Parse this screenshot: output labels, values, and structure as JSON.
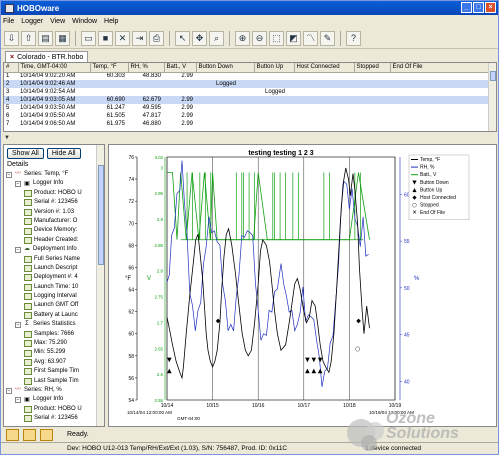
{
  "app": {
    "title": "HOBOware",
    "min_glyph": "_",
    "max_glyph": "□",
    "close_glyph": "×"
  },
  "menu": [
    "File",
    "Logger",
    "View",
    "Window",
    "Help"
  ],
  "document_tab": {
    "label": "Colorado - BTR.hobo",
    "close_glyph": "×"
  },
  "table": {
    "columns": [
      "#",
      "Time, GMT-04:00",
      "Temp, °F",
      "RH, %",
      "Batt., V",
      "Button Down",
      "Button Up",
      "Host Connected",
      "Stopped",
      "End Of File"
    ],
    "rows": [
      [
        "1",
        "10/14/04 9:02:20 AM",
        "60.303",
        "48.830",
        "2.99",
        "",
        "",
        "",
        "",
        ""
      ],
      [
        "2",
        "10/14/04 9:02:46 AM",
        "",
        "",
        "",
        "Logged",
        "",
        "",
        "",
        ""
      ],
      [
        "3",
        "10/14/04 9:02:54 AM",
        "",
        "",
        "",
        "",
        "Logged",
        "",
        "",
        ""
      ],
      [
        "4",
        "10/14/04 9:03:05 AM",
        "60.690",
        "62.679",
        "2.99",
        "",
        "",
        "",
        "",
        ""
      ],
      [
        "5",
        "10/14/04 9:03:50 AM",
        "61.247",
        "49.595",
        "2.99",
        "",
        "",
        "",
        "",
        ""
      ],
      [
        "6",
        "10/14/04 9:05:50 AM",
        "61.505",
        "47.817",
        "2.99",
        "",
        "",
        "",
        "",
        ""
      ],
      [
        "7",
        "10/14/04 9:06:50 AM",
        "61.975",
        "46.880",
        "2.99",
        "",
        "",
        "",
        "",
        ""
      ]
    ],
    "selected_rows": [
      1,
      3
    ]
  },
  "left_panel": {
    "show_all": "Show All",
    "hide_all": "Hide All",
    "details": "Details",
    "tree": [
      {
        "level": 0,
        "pm": "−",
        "icon": "chart-icon",
        "glyph": "〰",
        "label": "Series: Temp, °F"
      },
      {
        "level": 1,
        "pm": "−",
        "icon": "logger-icon",
        "glyph": "▣",
        "label": "Logger Info"
      },
      {
        "level": 2,
        "pm": "",
        "icon": "info-icon",
        "glyph": "",
        "label": "Product: HOBO U"
      },
      {
        "level": 2,
        "pm": "",
        "icon": "info-icon",
        "glyph": "",
        "label": "Serial #: 123456"
      },
      {
        "level": 2,
        "pm": "",
        "icon": "info-icon",
        "glyph": "",
        "label": "Version #: 1.03"
      },
      {
        "level": 2,
        "pm": "",
        "icon": "info-icon",
        "glyph": "",
        "label": "Manufacturer: O"
      },
      {
        "level": 2,
        "pm": "",
        "icon": "info-icon",
        "glyph": "",
        "label": "Device Memory:"
      },
      {
        "level": 2,
        "pm": "",
        "icon": "info-icon",
        "glyph": "",
        "label": "Header Created:"
      },
      {
        "level": 1,
        "pm": "−",
        "icon": "deployment-icon",
        "glyph": "☁",
        "label": "Deployment Info"
      },
      {
        "level": 2,
        "pm": "",
        "icon": "info-icon",
        "glyph": "",
        "label": "Full Series Name"
      },
      {
        "level": 2,
        "pm": "",
        "icon": "info-icon",
        "glyph": "",
        "label": "Launch Descript"
      },
      {
        "level": 2,
        "pm": "",
        "icon": "info-icon",
        "glyph": "",
        "label": "Deployment #: 4"
      },
      {
        "level": 2,
        "pm": "",
        "icon": "info-icon",
        "glyph": "",
        "label": "Launch Time: 10"
      },
      {
        "level": 2,
        "pm": "",
        "icon": "info-icon",
        "glyph": "",
        "label": "Logging Interval"
      },
      {
        "level": 2,
        "pm": "",
        "icon": "info-icon",
        "glyph": "",
        "label": "Launch GMT Off"
      },
      {
        "level": 2,
        "pm": "",
        "icon": "info-icon",
        "glyph": "",
        "label": "Battery at Launc"
      },
      {
        "level": 1,
        "pm": "−",
        "icon": "sigma-icon",
        "glyph": "Σ",
        "label": "Series Statistics"
      },
      {
        "level": 2,
        "pm": "",
        "icon": "info-icon",
        "glyph": "",
        "label": "Samples: 7666"
      },
      {
        "level": 2,
        "pm": "",
        "icon": "info-icon",
        "glyph": "",
        "label": "Max: 75.290"
      },
      {
        "level": 2,
        "pm": "",
        "icon": "info-icon",
        "glyph": "",
        "label": "Min: 55.299"
      },
      {
        "level": 2,
        "pm": "",
        "icon": "info-icon",
        "glyph": "",
        "label": "Avg: 63.907"
      },
      {
        "level": 2,
        "pm": "",
        "icon": "info-icon",
        "glyph": "",
        "label": "First Sample Tim"
      },
      {
        "level": 2,
        "pm": "",
        "icon": "info-icon",
        "glyph": "",
        "label": "Last Sample Tim"
      },
      {
        "level": 0,
        "pm": "−",
        "icon": "chart-icon",
        "glyph": "〰",
        "label": "Series: RH, %"
      },
      {
        "level": 1,
        "pm": "−",
        "icon": "logger-icon",
        "glyph": "▣",
        "label": "Logger Info"
      },
      {
        "level": 2,
        "pm": "",
        "icon": "info-icon",
        "glyph": "",
        "label": "Product: HOBO U"
      },
      {
        "level": 2,
        "pm": "",
        "icon": "info-icon",
        "glyph": "",
        "label": "Serial #: 123456"
      }
    ]
  },
  "chart_data": {
    "type": "line",
    "title": "testing testing 1 2 3",
    "left_axis": {
      "label": "°F",
      "ylim": [
        54,
        76
      ],
      "ticks": [
        54,
        56,
        58,
        60,
        62,
        64,
        66,
        68,
        70,
        72,
        74,
        76
      ]
    },
    "batt_axis": {
      "label": "V",
      "ylim": [
        2.55,
        3.02
      ],
      "ticks": [
        "2.55",
        "2.6",
        "2.65",
        "2.7",
        "2.75",
        "2.8",
        "2.85",
        "2.9",
        "2.95",
        "3",
        "3.02"
      ]
    },
    "right_axis": {
      "label": "%",
      "ylim": [
        38,
        64
      ],
      "ticks": [
        40,
        45,
        50,
        55,
        60
      ]
    },
    "x_ticks": [
      "10/14",
      "10/15",
      "10/16",
      "10/17",
      "10/18",
      "10/19"
    ],
    "x_start": "10/14/04 12:00:00 AM",
    "x_end": "10/19/04 12:00:00 AM",
    "x_unit_label": "GMT-04:00",
    "xlim": [
      "10/14",
      "10/19"
    ],
    "legend": {
      "position": "top-right",
      "entries": [
        {
          "label": "Temp, °F",
          "symbol": "line",
          "color": "#000000"
        },
        {
          "label": "RH, %",
          "symbol": "line",
          "color": "#2030c0"
        },
        {
          "label": "Batt., V",
          "symbol": "line",
          "color": "#10a010"
        },
        {
          "label": "Button Down",
          "symbol": "▼"
        },
        {
          "label": "Button Up",
          "symbol": "▲"
        },
        {
          "label": "Host Connected",
          "symbol": "◆"
        },
        {
          "label": "Stopped",
          "symbol": "○"
        },
        {
          "label": "End Of File",
          "symbol": "✕"
        }
      ]
    },
    "series": [
      {
        "name": "Temp, °F",
        "axis": "left",
        "color": "#000000",
        "x": [
          0.0,
          0.05,
          0.12,
          0.2,
          0.28,
          0.33,
          0.36,
          0.42,
          0.5,
          0.58,
          0.63,
          0.68,
          0.72,
          0.78,
          0.83,
          0.86,
          0.9,
          0.95,
          1.0,
          1.05,
          1.1,
          1.16,
          1.2,
          1.25,
          1.3,
          1.35,
          1.42,
          1.5,
          1.58,
          1.65,
          1.72,
          1.78,
          1.85,
          1.92,
          2.0,
          2.05,
          2.1,
          2.18,
          2.25,
          2.3,
          2.36,
          2.42,
          2.5,
          2.6,
          2.68,
          2.75,
          2.8,
          2.86,
          2.92,
          3.0,
          3.06,
          3.12,
          3.18,
          3.25,
          3.3,
          3.36,
          3.42,
          3.48,
          3.55,
          3.6,
          3.66,
          3.72,
          3.8,
          3.86,
          3.92,
          3.98,
          4.02,
          4.08,
          4.12,
          4.18,
          4.22,
          4.28,
          4.32,
          4.38,
          4.44
        ],
        "values": [
          61.5,
          60.5,
          59.0,
          57.5,
          56.5,
          56.0,
          57.0,
          60.0,
          63.5,
          66.5,
          68.5,
          69.0,
          67.5,
          65.0,
          62.0,
          60.0,
          58.5,
          57.5,
          57.0,
          57.5,
          58.5,
          61.0,
          64.0,
          67.0,
          69.0,
          69.5,
          68.0,
          65.5,
          62.5,
          60.0,
          58.5,
          58.0,
          58.5,
          61.0,
          64.5,
          67.5,
          68.5,
          68.0,
          66.5,
          64.5,
          62.0,
          60.0,
          58.5,
          59.0,
          61.0,
          63.0,
          64.5,
          65.0,
          64.0,
          62.0,
          61.0,
          61.5,
          63.0,
          62.5,
          61.0,
          59.0,
          57.5,
          57.0,
          56.5,
          57.5,
          60.0,
          64.0,
          70.0,
          73.5,
          75.0,
          74.0,
          72.5,
          74.5,
          73.0,
          70.0,
          66.0,
          62.0,
          60.0,
          62.5,
          60.5
        ]
      },
      {
        "name": "RH, %",
        "axis": "right",
        "color": "#2030c0",
        "x": [
          0.0,
          0.05,
          0.1,
          0.16,
          0.22,
          0.28,
          0.33,
          0.38,
          0.44,
          0.5,
          0.56,
          0.62,
          0.68,
          0.74,
          0.8,
          0.86,
          0.92,
          0.98,
          1.04,
          1.1,
          1.16,
          1.22,
          1.28,
          1.34,
          1.4,
          1.46,
          1.52,
          1.58,
          1.64,
          1.7,
          1.76,
          1.82,
          1.88,
          1.94,
          2.0,
          2.06,
          2.12,
          2.18,
          2.24,
          2.3,
          2.36,
          2.42,
          2.5,
          2.56,
          2.62,
          2.68,
          2.74,
          2.8,
          2.86,
          2.92,
          2.98,
          3.04,
          3.1,
          3.16,
          3.22,
          3.28,
          3.34,
          3.4,
          3.46,
          3.52,
          3.58,
          3.64,
          3.7,
          3.76,
          3.82,
          3.88,
          3.94,
          4.0,
          4.06,
          4.12,
          4.18,
          4.24,
          4.3,
          4.36,
          4.42
        ],
        "values": [
          50.0,
          52.0,
          55.0,
          57.0,
          59.5,
          61.0,
          63.0,
          60.0,
          55.0,
          50.0,
          47.5,
          46.0,
          47.0,
          49.0,
          52.0,
          55.0,
          57.0,
          56.5,
          55.5,
          55.5,
          54.0,
          51.0,
          48.0,
          46.0,
          45.5,
          46.0,
          48.5,
          52.0,
          55.0,
          56.0,
          55.5,
          56.5,
          55.0,
          51.0,
          47.0,
          45.0,
          44.5,
          45.5,
          47.0,
          48.0,
          49.0,
          50.5,
          52.0,
          51.0,
          48.5,
          48.0,
          47.0,
          46.0,
          45.5,
          48.0,
          49.5,
          47.0,
          46.5,
          47.5,
          46.0,
          45.0,
          42.0,
          40.0,
          40.5,
          42.0,
          43.5,
          45.5,
          48.0,
          53.0,
          58.0,
          62.0,
          60.5,
          59.0,
          60.0,
          58.0,
          56.0,
          55.0,
          57.0,
          54.0,
          53.0
        ]
      },
      {
        "name": "Batt., V",
        "axis": "batt",
        "color": "#10a010",
        "x": [
          0.0,
          0.12,
          0.22,
          0.3,
          0.42,
          0.55,
          0.7,
          0.82,
          0.95,
          1.0,
          1.1,
          1.3,
          1.5,
          1.7,
          1.9,
          2.0,
          2.2,
          2.5,
          2.8,
          3.0,
          3.3,
          3.6,
          3.8,
          4.0,
          4.2,
          4.44
        ],
        "values": [
          2.99,
          2.99,
          2.86,
          2.99,
          2.86,
          2.99,
          2.86,
          2.99,
          2.86,
          2.99,
          2.86,
          2.86,
          2.86,
          2.86,
          2.86,
          2.99,
          2.86,
          2.86,
          2.86,
          2.86,
          2.86,
          2.86,
          2.86,
          2.86,
          2.99,
          2.86
        ]
      }
    ],
    "events": [
      {
        "name": "Button Down",
        "symbol": "▼",
        "x": [
          0.05,
          3.08,
          3.22,
          3.36
        ],
        "y": 57.5
      },
      {
        "name": "Button Up",
        "symbol": "▲",
        "x": [
          0.05,
          3.08,
          3.22,
          3.36
        ],
        "y": 56.5
      },
      {
        "name": "Host Connected",
        "symbol": "◆",
        "x": [
          1.12,
          4.2
        ],
        "y": 61.0
      },
      {
        "name": "Stopped",
        "symbol": "○",
        "x": [
          4.18
        ],
        "y": 58.5
      },
      {
        "name": "End Of File",
        "symbol": "✕",
        "x": [],
        "y": 58.0
      }
    ]
  },
  "status": {
    "ready": "Ready.",
    "device": "Dev: HOBO U12-013 Temp/RH/Ext/Ext (1.03), S/N: 756487, Prod. ID: 0x11C",
    "connected": "1 device connected"
  },
  "watermark": {
    "line1": "Ozone",
    "line2": "Solutions"
  },
  "icons": {
    "toolbar": [
      "readout-icon",
      "launch-icon",
      "status-icon",
      "save-icon",
      "open-icon",
      "save-disk-icon",
      "delete-icon",
      "export-icon",
      "print-icon",
      "select-icon",
      "hand-icon",
      "zoom-icon",
      "zoom-in-icon",
      "zoom-out-icon",
      "fit-icon",
      "color-icon",
      "graph-icon",
      "preferences-icon",
      "help-icon"
    ]
  }
}
